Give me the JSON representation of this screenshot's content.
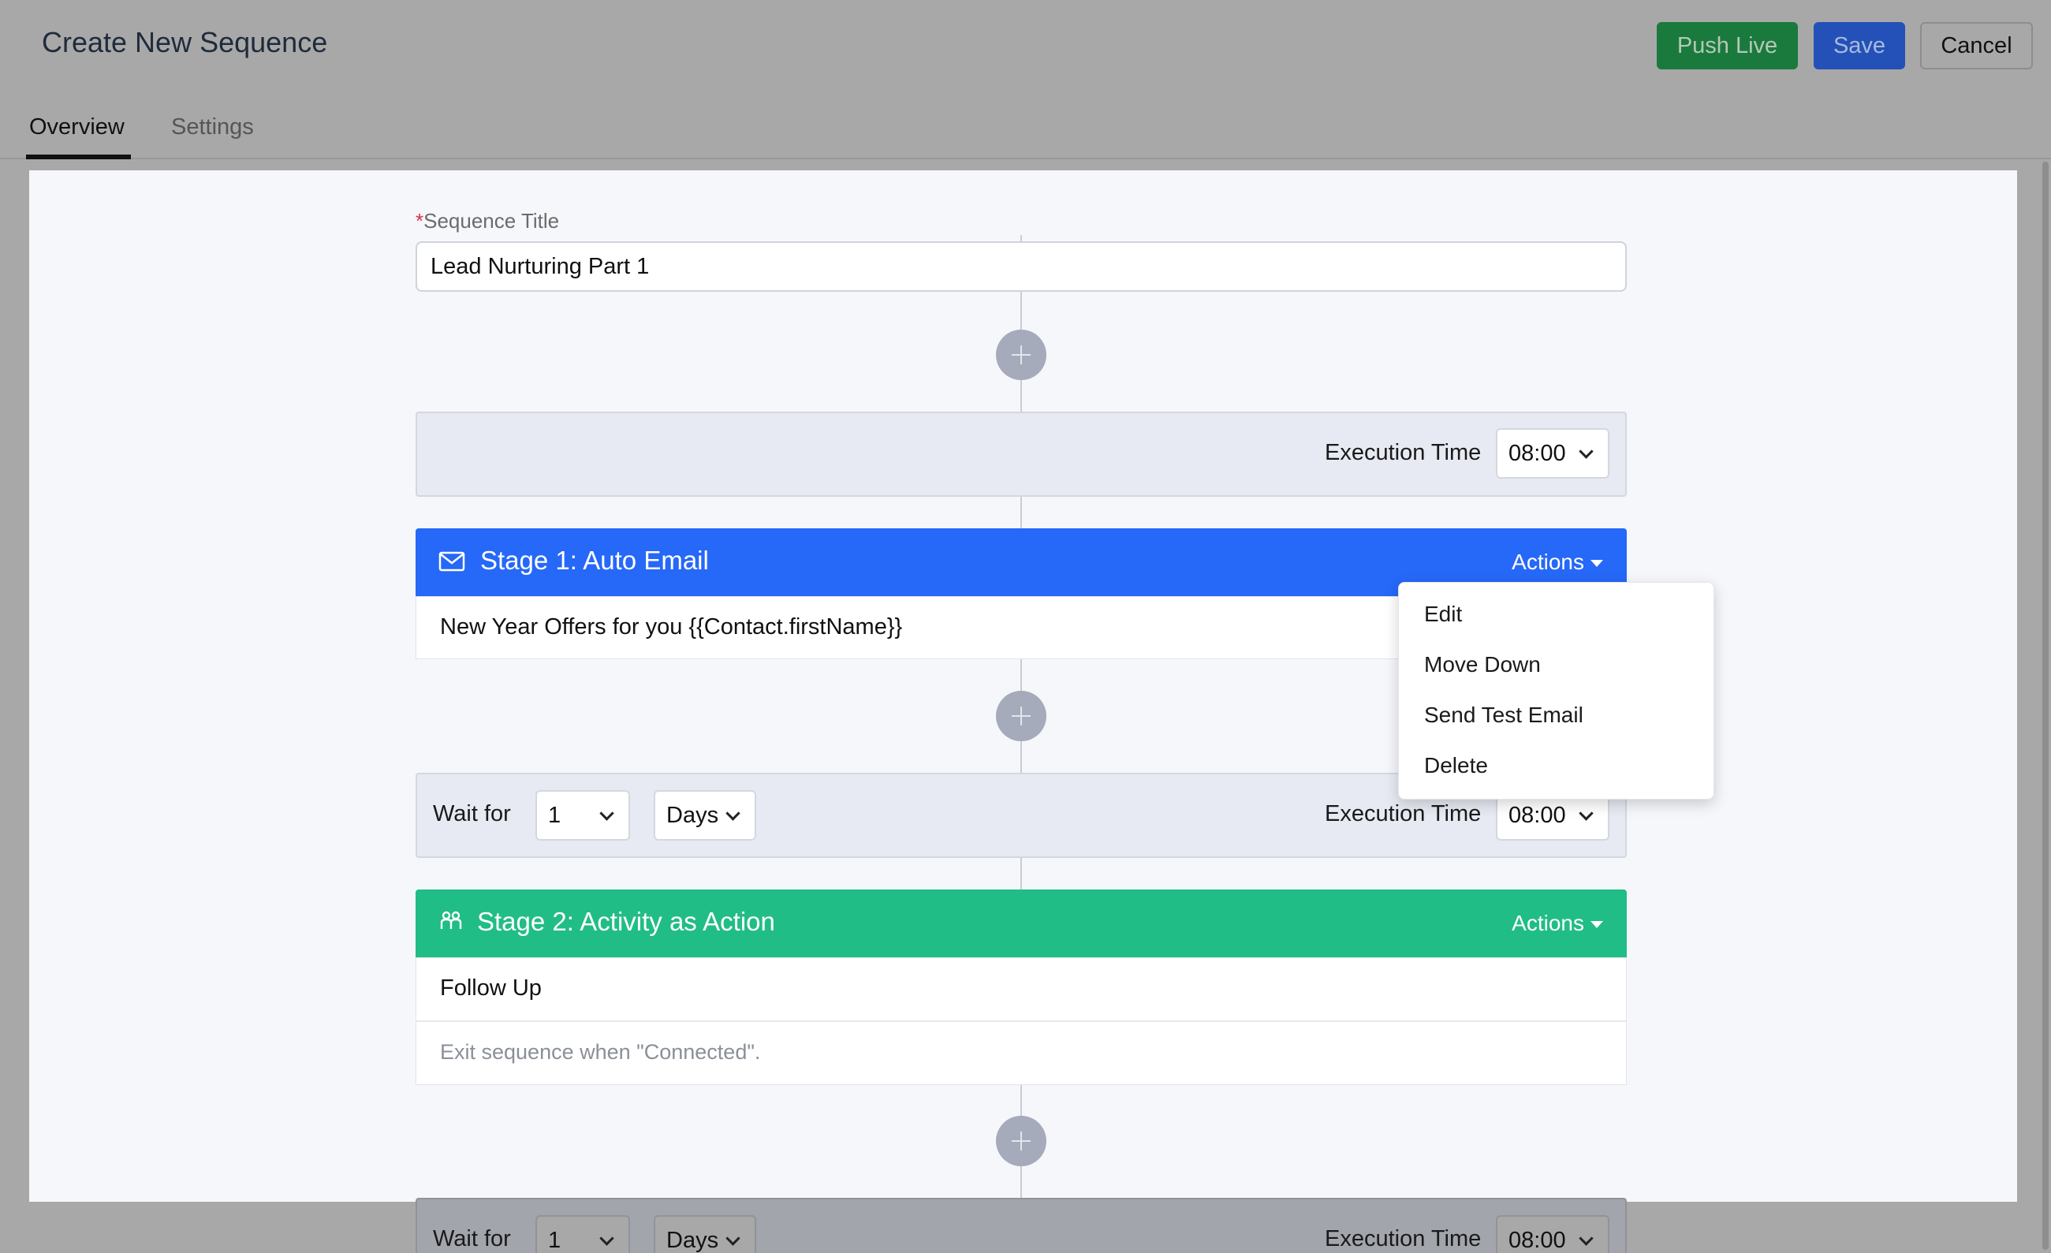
{
  "header": {
    "title": "Create New Sequence",
    "push_live_label": "Push Live",
    "save_label": "Save",
    "cancel_label": "Cancel"
  },
  "tabs": [
    {
      "label": "Overview",
      "active": true
    },
    {
      "label": "Settings",
      "active": false
    }
  ],
  "sequence": {
    "title_label": "Sequence Title",
    "required_mark": "*",
    "title_value": "Lead Nurturing Part 1"
  },
  "execution": {
    "label": "Execution Time",
    "time_value": "08:00"
  },
  "stages": [
    {
      "title": "Stage 1: Auto Email",
      "icon": "envelope-icon",
      "color": "#2668f7",
      "actions_label": "Actions",
      "body": "New Year Offers for you {{Contact.firstName}}"
    },
    {
      "title": "Stage 2: Activity as Action",
      "icon": "activity-icon",
      "color": "#21bd86",
      "actions_label": "Actions",
      "body": "Follow Up",
      "note": "Exit sequence when \"Connected\"."
    }
  ],
  "waits": [
    {
      "label": "Wait for",
      "count": "1",
      "unit": "Days",
      "exec_label": "Execution Time",
      "time": "08:00"
    },
    {
      "label": "Wait for",
      "count": "1",
      "unit": "Days",
      "exec_label": "Execution Time",
      "time": "08:00"
    }
  ],
  "actions_menu": {
    "items": [
      "Edit",
      "Move Down",
      "Send Test Email",
      "Delete"
    ]
  }
}
